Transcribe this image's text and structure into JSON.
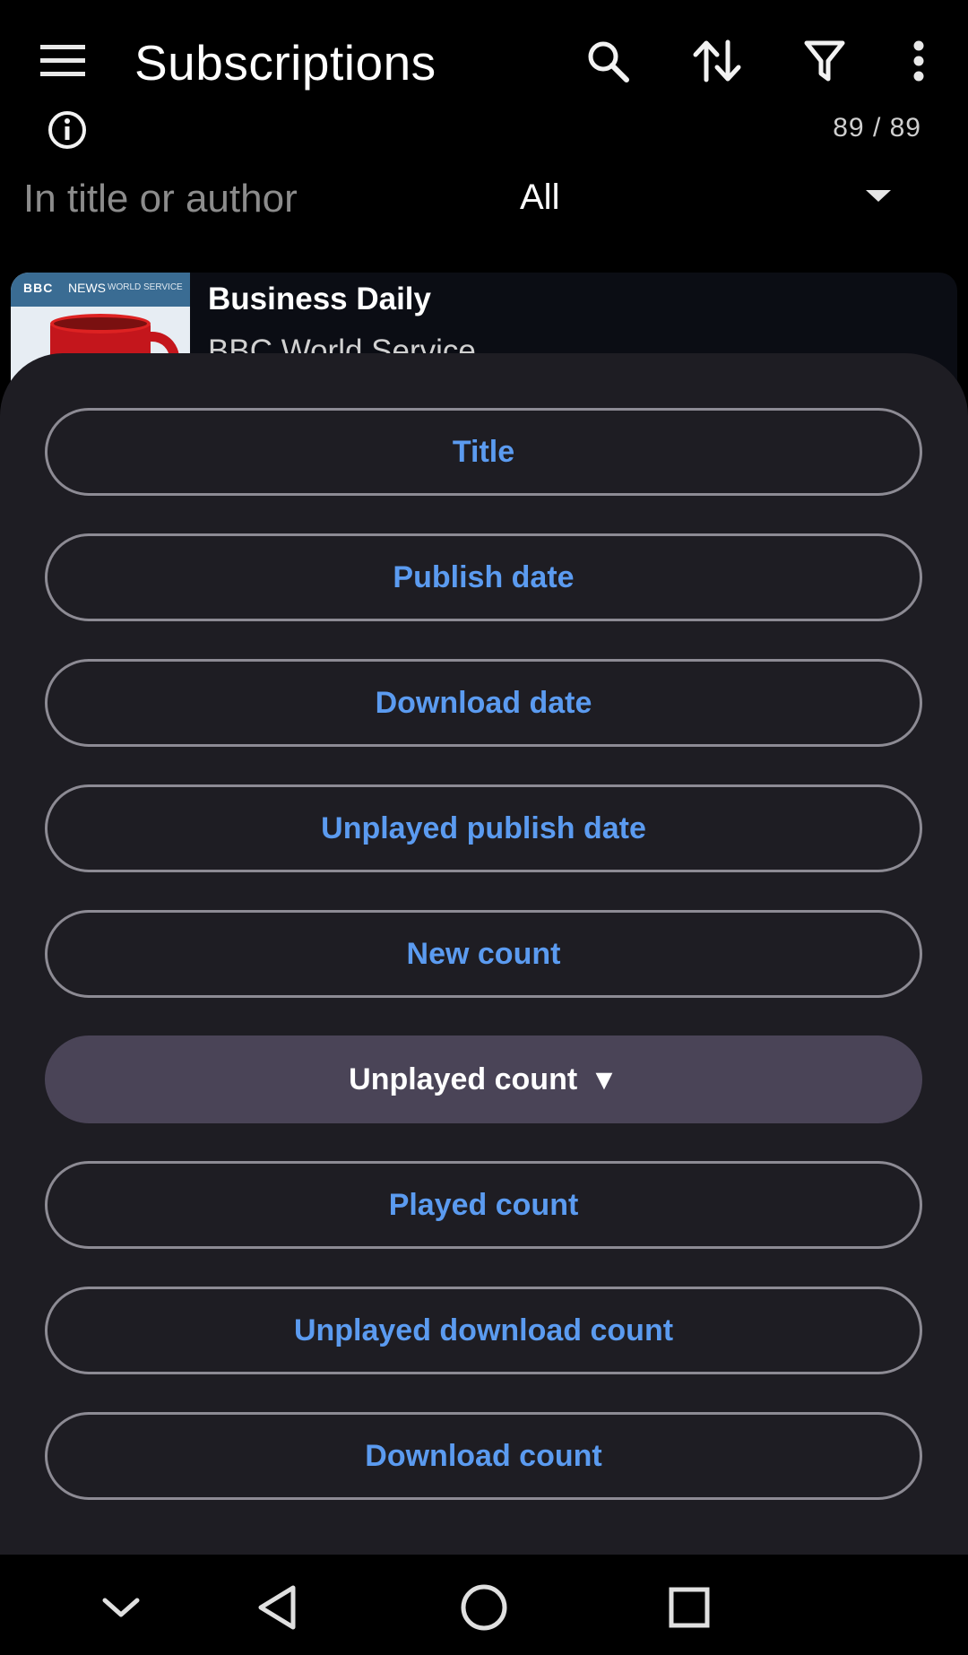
{
  "app_bar": {
    "title": "Subscriptions",
    "icons": {
      "menu": "menu-icon",
      "search": "search-icon",
      "sort": "sort-icon",
      "filter": "filter-icon",
      "more": "more-vert-icon"
    }
  },
  "info_icon": "info-icon",
  "subscription_count": "89 / 89",
  "filter": {
    "search_placeholder": "In title or author",
    "category_value": "All"
  },
  "list": {
    "items": [
      {
        "title": "Business Daily",
        "author": "BBC World Service",
        "artwork_brand": "BBC",
        "artwork_sub": "NEWS",
        "artwork_tag": "WORLD SERVICE"
      }
    ]
  },
  "sort_sheet": {
    "options": [
      {
        "label": "Title",
        "selected": false
      },
      {
        "label": "Publish date",
        "selected": false
      },
      {
        "label": "Download date",
        "selected": false
      },
      {
        "label": "Unplayed publish date",
        "selected": false
      },
      {
        "label": "New count",
        "selected": false
      },
      {
        "label": "Unplayed count",
        "selected": true,
        "direction": "▼"
      },
      {
        "label": "Played count",
        "selected": false
      },
      {
        "label": "Unplayed download count",
        "selected": false
      },
      {
        "label": "Download count",
        "selected": false
      }
    ]
  },
  "nav_bar": {
    "icons": [
      "hide-keyboard-icon",
      "back-icon",
      "home-icon",
      "recents-icon"
    ]
  },
  "colors": {
    "background": "#000000",
    "sheet": "#1e1d23",
    "accent_text": "#5b9bf0",
    "selected_chip": "#4a4457",
    "outline": "#8d8b94"
  }
}
